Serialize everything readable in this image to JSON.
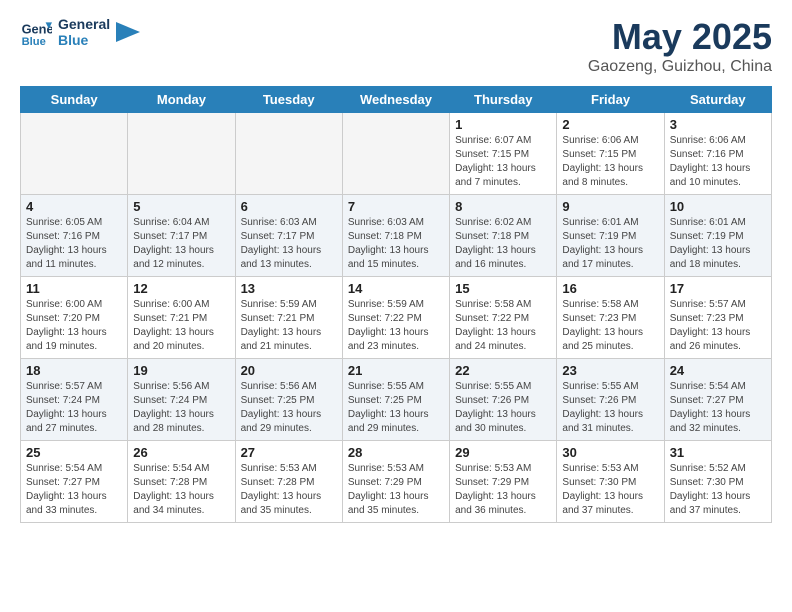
{
  "header": {
    "logo_line1": "General",
    "logo_line2": "Blue",
    "month_year": "May 2025",
    "location": "Gaozeng, Guizhou, China"
  },
  "days_of_week": [
    "Sunday",
    "Monday",
    "Tuesday",
    "Wednesday",
    "Thursday",
    "Friday",
    "Saturday"
  ],
  "weeks": [
    [
      {
        "day": "",
        "empty": true
      },
      {
        "day": "",
        "empty": true
      },
      {
        "day": "",
        "empty": true
      },
      {
        "day": "",
        "empty": true
      },
      {
        "day": "1",
        "rise": "6:07 AM",
        "set": "7:15 PM",
        "daylight": "13 hours and 7 minutes."
      },
      {
        "day": "2",
        "rise": "6:06 AM",
        "set": "7:15 PM",
        "daylight": "13 hours and 8 minutes."
      },
      {
        "day": "3",
        "rise": "6:06 AM",
        "set": "7:16 PM",
        "daylight": "13 hours and 10 minutes."
      }
    ],
    [
      {
        "day": "4",
        "rise": "6:05 AM",
        "set": "7:16 PM",
        "daylight": "13 hours and 11 minutes."
      },
      {
        "day": "5",
        "rise": "6:04 AM",
        "set": "7:17 PM",
        "daylight": "13 hours and 12 minutes."
      },
      {
        "day": "6",
        "rise": "6:03 AM",
        "set": "7:17 PM",
        "daylight": "13 hours and 13 minutes."
      },
      {
        "day": "7",
        "rise": "6:03 AM",
        "set": "7:18 PM",
        "daylight": "13 hours and 15 minutes."
      },
      {
        "day": "8",
        "rise": "6:02 AM",
        "set": "7:18 PM",
        "daylight": "13 hours and 16 minutes."
      },
      {
        "day": "9",
        "rise": "6:01 AM",
        "set": "7:19 PM",
        "daylight": "13 hours and 17 minutes."
      },
      {
        "day": "10",
        "rise": "6:01 AM",
        "set": "7:19 PM",
        "daylight": "13 hours and 18 minutes."
      }
    ],
    [
      {
        "day": "11",
        "rise": "6:00 AM",
        "set": "7:20 PM",
        "daylight": "13 hours and 19 minutes."
      },
      {
        "day": "12",
        "rise": "6:00 AM",
        "set": "7:21 PM",
        "daylight": "13 hours and 20 minutes."
      },
      {
        "day": "13",
        "rise": "5:59 AM",
        "set": "7:21 PM",
        "daylight": "13 hours and 21 minutes."
      },
      {
        "day": "14",
        "rise": "5:59 AM",
        "set": "7:22 PM",
        "daylight": "13 hours and 23 minutes."
      },
      {
        "day": "15",
        "rise": "5:58 AM",
        "set": "7:22 PM",
        "daylight": "13 hours and 24 minutes."
      },
      {
        "day": "16",
        "rise": "5:58 AM",
        "set": "7:23 PM",
        "daylight": "13 hours and 25 minutes."
      },
      {
        "day": "17",
        "rise": "5:57 AM",
        "set": "7:23 PM",
        "daylight": "13 hours and 26 minutes."
      }
    ],
    [
      {
        "day": "18",
        "rise": "5:57 AM",
        "set": "7:24 PM",
        "daylight": "13 hours and 27 minutes."
      },
      {
        "day": "19",
        "rise": "5:56 AM",
        "set": "7:24 PM",
        "daylight": "13 hours and 28 minutes."
      },
      {
        "day": "20",
        "rise": "5:56 AM",
        "set": "7:25 PM",
        "daylight": "13 hours and 29 minutes."
      },
      {
        "day": "21",
        "rise": "5:55 AM",
        "set": "7:25 PM",
        "daylight": "13 hours and 29 minutes."
      },
      {
        "day": "22",
        "rise": "5:55 AM",
        "set": "7:26 PM",
        "daylight": "13 hours and 30 minutes."
      },
      {
        "day": "23",
        "rise": "5:55 AM",
        "set": "7:26 PM",
        "daylight": "13 hours and 31 minutes."
      },
      {
        "day": "24",
        "rise": "5:54 AM",
        "set": "7:27 PM",
        "daylight": "13 hours and 32 minutes."
      }
    ],
    [
      {
        "day": "25",
        "rise": "5:54 AM",
        "set": "7:27 PM",
        "daylight": "13 hours and 33 minutes."
      },
      {
        "day": "26",
        "rise": "5:54 AM",
        "set": "7:28 PM",
        "daylight": "13 hours and 34 minutes."
      },
      {
        "day": "27",
        "rise": "5:53 AM",
        "set": "7:28 PM",
        "daylight": "13 hours and 35 minutes."
      },
      {
        "day": "28",
        "rise": "5:53 AM",
        "set": "7:29 PM",
        "daylight": "13 hours and 35 minutes."
      },
      {
        "day": "29",
        "rise": "5:53 AM",
        "set": "7:29 PM",
        "daylight": "13 hours and 36 minutes."
      },
      {
        "day": "30",
        "rise": "5:53 AM",
        "set": "7:30 PM",
        "daylight": "13 hours and 37 minutes."
      },
      {
        "day": "31",
        "rise": "5:52 AM",
        "set": "7:30 PM",
        "daylight": "13 hours and 37 minutes."
      }
    ]
  ],
  "labels": {
    "sunrise_prefix": "Sunrise: ",
    "sunset_prefix": "Sunset: ",
    "daylight_prefix": "Daylight: "
  }
}
